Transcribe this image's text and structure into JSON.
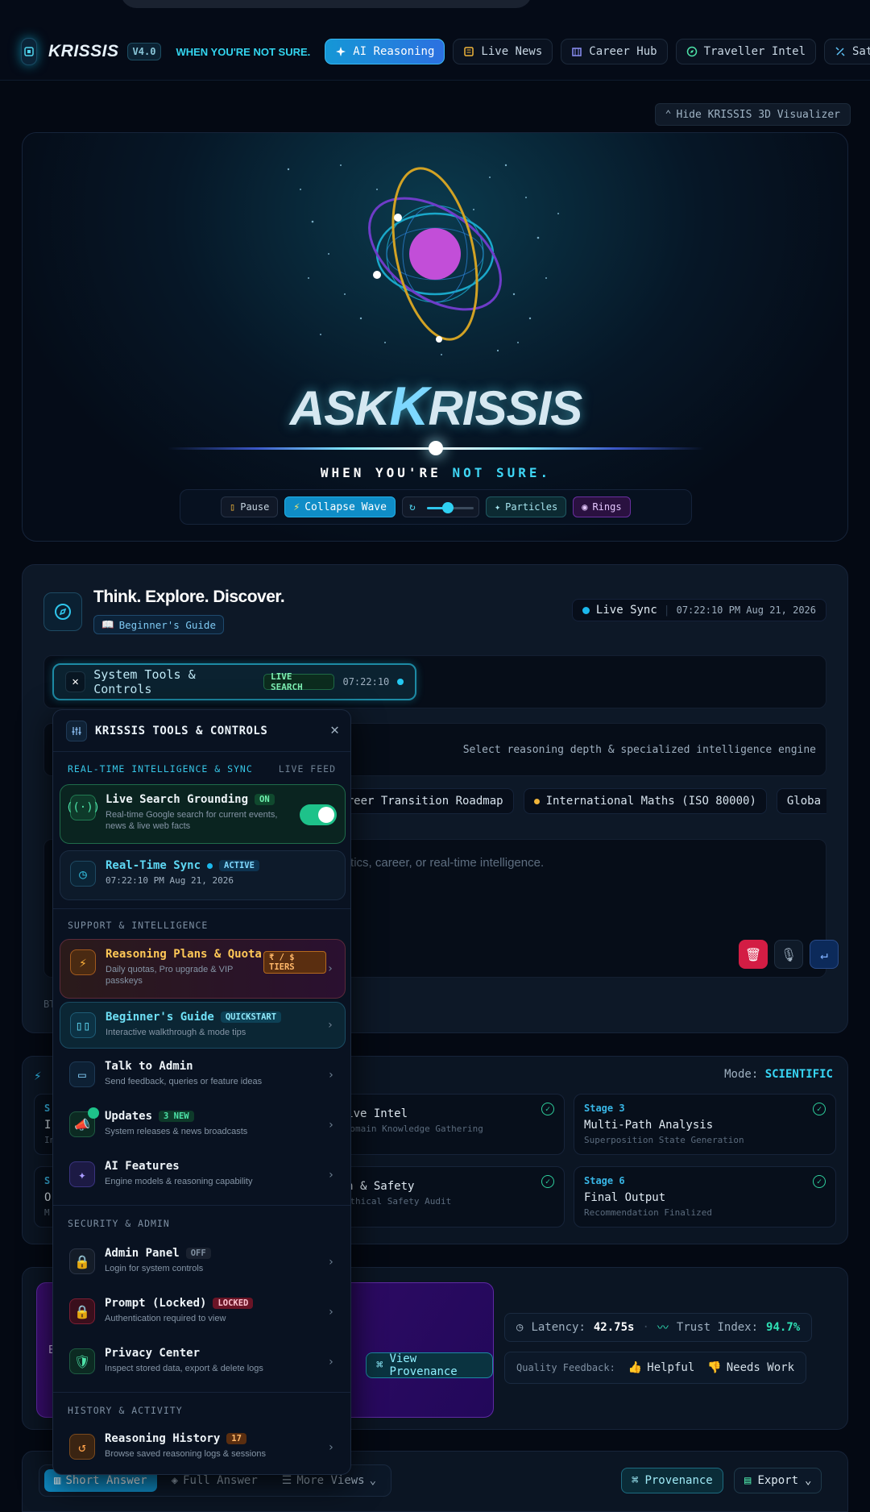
{
  "nav": {
    "logo": "KRISSIS",
    "version": "V4.0",
    "motto": "WHEN YOU'RE NOT SURE.",
    "tabs": [
      {
        "label": "AI Reasoning",
        "icon": "sparkle-icon"
      },
      {
        "label": "Live News",
        "icon": "newspaper-icon"
      },
      {
        "label": "Career Hub",
        "icon": "building-icon"
      },
      {
        "label": "Traveller Intel",
        "icon": "compass-icon"
      },
      {
        "label": "Satell",
        "icon": "satellite-icon"
      }
    ]
  },
  "visualizer": {
    "hide_label": "Hide KRISSIS 3D Visualizer",
    "title_ask": "ASK",
    "title_k": "K",
    "title_rest": "RISSIS",
    "subtitle_a": "WHEN YOU'RE ",
    "subtitle_b": "NOT SURE.",
    "controls": {
      "pause": "Pause",
      "collapse": "Collapse Wave",
      "particles": "Particles",
      "rings": "Rings",
      "speed_level": 0.45
    }
  },
  "main": {
    "title": "Think. Explore. Discover.",
    "guide": "Beginner's Guide",
    "live_sync_label": "Live Sync",
    "live_sync_time": "07:22:10 PM Aug 21, 2026",
    "tools_button": "System Tools & Controls",
    "live_search_badge": "LIVE SEARCH",
    "tools_time": "07:22:10",
    "depth_hint": "Select reasoning depth & specialized intelligence engine",
    "chips": [
      "e Career Transition Roadmap",
      "International Maths (ISO 80000)",
      "Globa"
    ],
    "prompt_placeholder": "athematics, career, or real-time intelligence.",
    "bt": "BT"
  },
  "pipeline": {
    "mode_label": "Mode:",
    "mode_value": "SCIENTIFIC",
    "stages": [
      {
        "num": "S",
        "title": "I",
        "desc": "In"
      },
      {
        "num": "",
        "title": "dge/Live Intel",
        "desc": "rch & Domain Knowledge Gathering"
      },
      {
        "num": "Stage 3",
        "title": "Multi-Path Analysis",
        "desc": "Superposition State Generation"
      },
      {
        "num": "S",
        "title": "O",
        "desc": "M"
      },
      {
        "num": "",
        "title": "cation & Safety",
        "desc": "ncy & Ethical Safety Audit"
      },
      {
        "num": "Stage 6",
        "title": "Final Output",
        "desc": "Recommendation Finalized"
      }
    ]
  },
  "result": {
    "provenance_btn": "View Provenance",
    "latency_label": "Latency:",
    "latency_value": "42.75s",
    "trust_label": "Trust Index:",
    "trust_value": "94.7%",
    "feedback_label": "Quality Feedback:",
    "helpful": "Helpful",
    "needs_work": "Needs Work",
    "left_letter": "E"
  },
  "bottom": {
    "tab_short": "Short Answer",
    "tab_full": "Full Answer",
    "tab_more": "More Views",
    "provenance": "Provenance",
    "export": "Export"
  },
  "panel": {
    "title": "KRISSIS TOOLS & CONTROLS",
    "sec1": "REAL-TIME INTELLIGENCE & SYNC",
    "sec1_right": "LIVE FEED",
    "live_search_title": "Live Search Grounding",
    "live_search_badge": "ON",
    "live_search_desc": "Real-time Google search for current events, news & live web facts",
    "sync_title": "Real-Time Sync",
    "sync_badge": "ACTIVE",
    "sync_time": "07:22:10 PM Aug 21, 2026",
    "sec2": "SUPPORT & INTELLIGENCE",
    "plans_title": "Reasoning Plans & Quota",
    "plans_badge": "₹ / $ TIERS",
    "plans_desc": "Daily quotas, Pro upgrade & VIP passkeys",
    "guide_title": "Beginner's Guide",
    "guide_badge": "QUICKSTART",
    "guide_desc": "Interactive walkthrough & mode tips",
    "admin_talk_title": "Talk to Admin",
    "admin_talk_desc": "Send feedback, queries or feature ideas",
    "updates_title": "Updates",
    "updates_badge": "3 NEW",
    "updates_desc": "System releases & news broadcasts",
    "features_title": "AI Features",
    "features_desc": "Engine models & reasoning capability",
    "sec3": "SECURITY & ADMIN",
    "admin_panel_title": "Admin Panel",
    "admin_panel_badge": "OFF",
    "admin_panel_desc": "Login for system controls",
    "prompt_title": "Prompt (Locked)",
    "prompt_badge": "LOCKED",
    "prompt_desc": "Authentication required to view",
    "privacy_title": "Privacy Center",
    "privacy_desc": "Inspect stored data, export & delete logs",
    "sec4": "HISTORY & ACTIVITY",
    "history_title": "Reasoning History",
    "history_badge": "17",
    "history_desc": "Browse saved reasoning logs & sessions"
  }
}
